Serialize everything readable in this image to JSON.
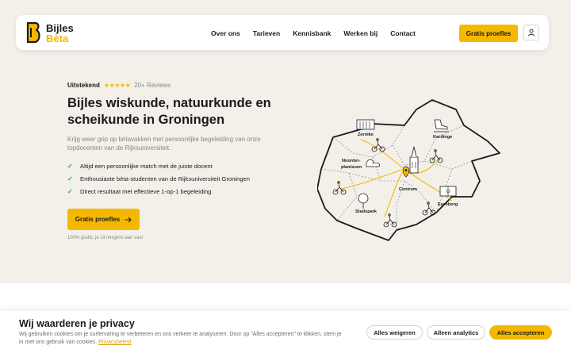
{
  "nav": {
    "logo_line1": "Bijles",
    "logo_line2": "Bèta",
    "links": [
      "Over ons",
      "Tarieven",
      "Kennisbank",
      "Werken bij",
      "Contact"
    ],
    "cta": "Gratis proefles",
    "user_icon": "user-icon"
  },
  "hero": {
    "rating_label": "Uitstekend",
    "stars": "★★★★★",
    "reviews": "20+ Reviews",
    "title": "Bijles wiskunde, natuurkunde en scheikunde in Groningen",
    "subtitle": "Krijg weer grip op bètavakken met persoonlijke begeleiding van onze topdocenten van de Rijksuniversiteit.",
    "checks": [
      "Altijd een persoonlijke match met de juiste docent",
      "Enthousiaste bèta-studenten van de Rijksuniversiteit Groningen",
      "Direct resultaat met effectieve 1-op-1 begeleiding"
    ],
    "cta": "Gratis proefles",
    "fineprint": "100% gratis, je zit nergens aan vast"
  },
  "map": {
    "labels": [
      "Zernike",
      "Kardinge",
      "Noorder-",
      "plantsoen",
      "Centrum",
      "Euroborg",
      "Stadspark"
    ]
  },
  "cookie": {
    "title": "Wij waarderen je privacy",
    "text": "Wij gebruiken cookies om je surfervaring te verbeteren en ons verkeer te analyseren. Door op \"Alles accepteren\" te klikken, stem je in met ons gebruik van cookies.",
    "link": "Privacybeleid",
    "reject": "Alles weigeren",
    "analytics": "Alleen analytics",
    "accept": "Alles accepteren"
  },
  "colors": {
    "accent": "#f5b800",
    "background": "#f3f0ea",
    "check": "#2ca54a"
  }
}
